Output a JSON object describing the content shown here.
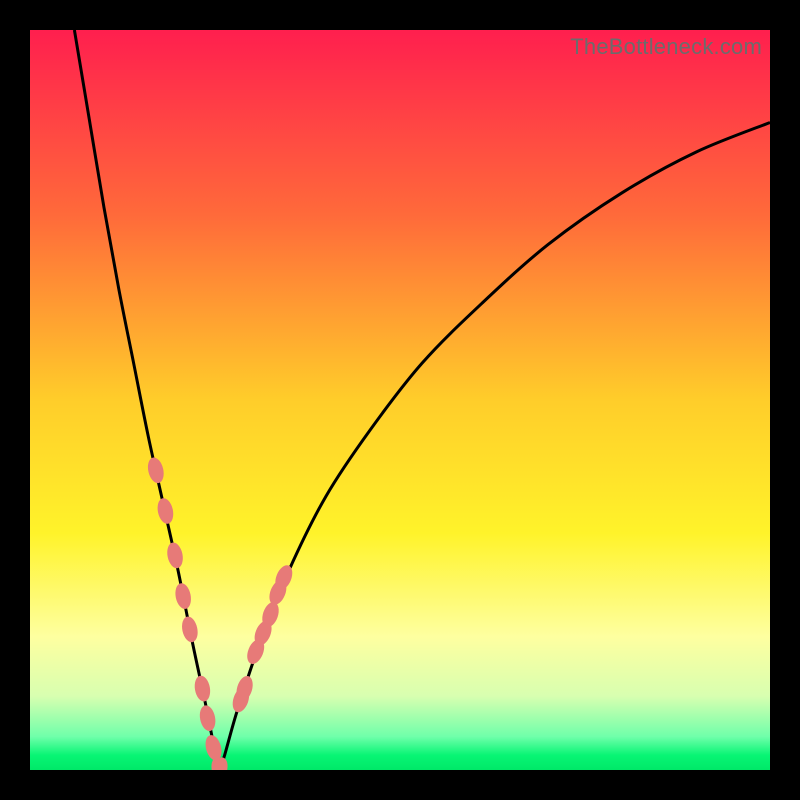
{
  "watermark": "TheBottleneck.com",
  "colors": {
    "frame": "#000000",
    "gradient_stops": [
      {
        "pct": 0.0,
        "hex": "#ff1f4e"
      },
      {
        "pct": 0.25,
        "hex": "#ff6a3a"
      },
      {
        "pct": 0.5,
        "hex": "#ffcd2a"
      },
      {
        "pct": 0.68,
        "hex": "#fff32a"
      },
      {
        "pct": 0.82,
        "hex": "#feffa0"
      },
      {
        "pct": 0.9,
        "hex": "#d8ffb0"
      },
      {
        "pct": 0.955,
        "hex": "#6fffaa"
      },
      {
        "pct": 0.98,
        "hex": "#08f574"
      },
      {
        "pct": 1.0,
        "hex": "#00e868"
      }
    ],
    "curve": "#000000",
    "highlight": "#e77a78"
  },
  "chart_data": {
    "type": "line",
    "title": "",
    "xlabel": "",
    "ylabel": "",
    "xlim": [
      0,
      100
    ],
    "ylim": [
      0,
      100
    ],
    "series": [
      {
        "name": "left-branch",
        "x": [
          6,
          8,
          10,
          12,
          14,
          16,
          18,
          20,
          22,
          23.5,
          24.5,
          25.2,
          25.6
        ],
        "y": [
          100,
          88,
          76,
          65,
          55,
          45,
          36,
          27,
          17,
          10,
          5,
          1.5,
          0
        ]
      },
      {
        "name": "right-branch",
        "x": [
          25.6,
          26.3,
          28,
          31,
          35,
          40,
          46,
          53,
          61,
          70,
          80,
          90,
          100
        ],
        "y": [
          0,
          2,
          8,
          17,
          27,
          37,
          46,
          55,
          63,
          71,
          78,
          83.5,
          87.5
        ]
      }
    ],
    "highlights": [
      {
        "branch": "left",
        "x": [
          17.0,
          18.3,
          19.6,
          20.7,
          21.6,
          23.3,
          24.0,
          24.8,
          25.6
        ],
        "y": [
          40.5,
          35.0,
          29.0,
          23.5,
          19.0,
          11.0,
          7.0,
          3.0,
          0.0
        ]
      },
      {
        "branch": "right",
        "x": [
          25.6,
          28.5,
          29.0,
          30.5,
          31.5,
          32.5,
          33.5,
          34.3
        ],
        "y": [
          0.0,
          9.5,
          11.0,
          16.0,
          18.5,
          21.0,
          24.0,
          26.0
        ]
      }
    ]
  }
}
